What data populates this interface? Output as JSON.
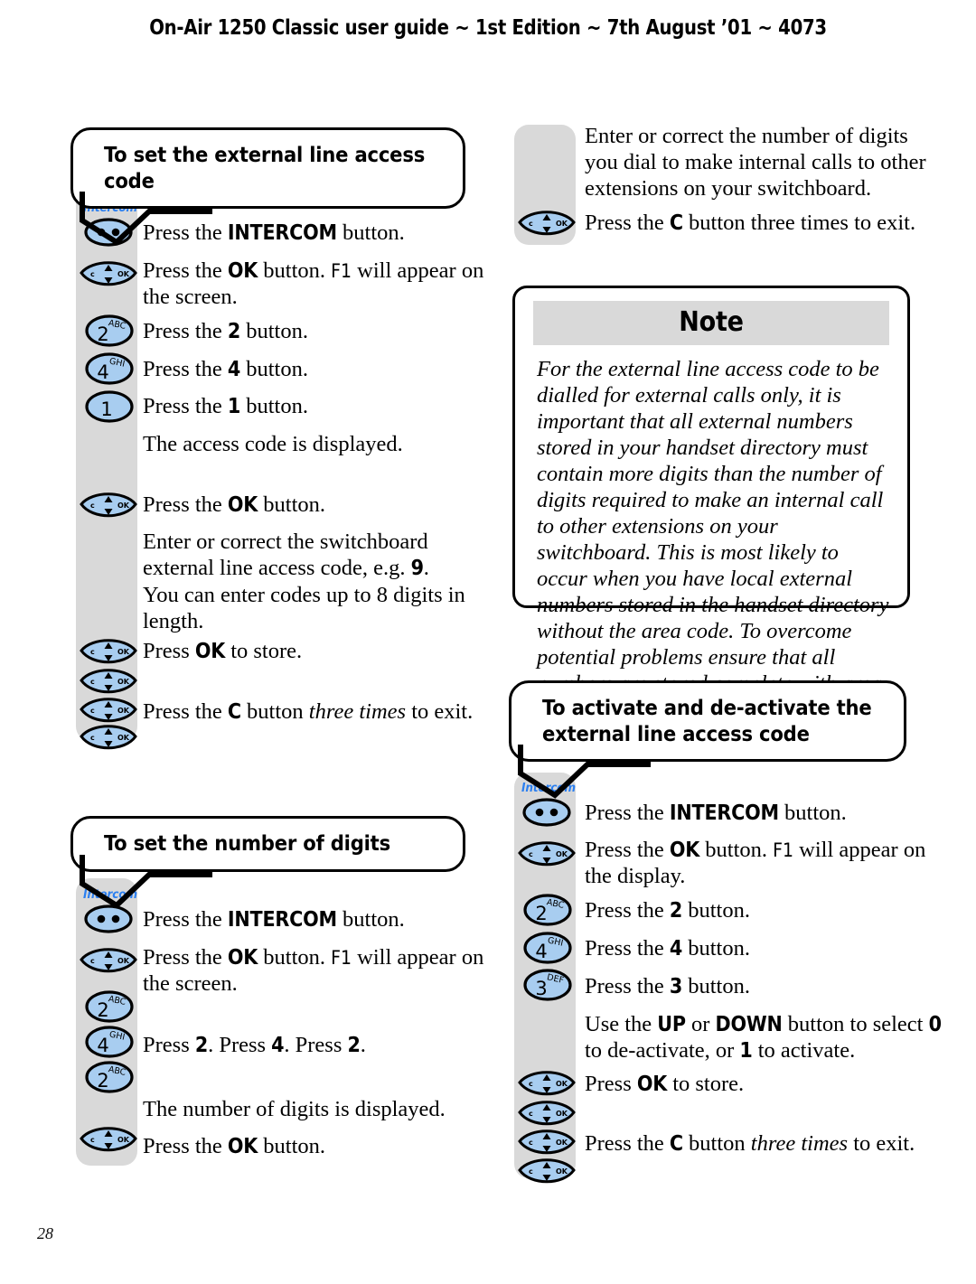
{
  "page": {
    "running_head": "On-Air 1250 Classic user guide ~ 1st Edition ~ 7th August ’01 ~ 4073",
    "page_number": "28",
    "colors": {
      "key_fill": "#a8cdf0",
      "strip_gray": "#d9d9d9",
      "intercom_blue": "#2b7ff0",
      "outline": "#000000"
    }
  },
  "sections": {
    "external_line_access_code": {
      "title": "To set the external line access code",
      "steps": [
        {
          "text_html": "Press the <b>INTERCOM</b> button.",
          "key": "intercom"
        },
        {
          "text_html": "Press the <b>OK</b> button. <span class=\"mono-f1\">F1</span> will appear on the screen.",
          "key": "nav"
        },
        {
          "text_html": "Press the <b>2</b> button.",
          "key": "2"
        },
        {
          "text_html": "Press the <b>4</b> button.",
          "key": "4"
        },
        {
          "text_html": "Press the <b>1</b> button.",
          "key": "1"
        },
        {
          "text_html": "The access code is displayed.",
          "key": null
        },
        {
          "text_html": "Press the <b>OK</b> button.",
          "key": "nav"
        },
        {
          "text_html": "Enter or correct the switchboard external line access code, e.g. <b>9</b>. You can enter codes up to 8 digits in length.",
          "key": null
        },
        {
          "text_html": "Press <b>OK</b> to store.",
          "key": "nav"
        },
        {
          "text_html": "Press the <b>C</b> button <i>three times</i> to exit.",
          "key": "nav"
        }
      ]
    },
    "number_of_digits": {
      "title": "To set the number of digits",
      "steps": [
        {
          "text_html": "Press the <b>INTERCOM</b> button.",
          "key": "intercom"
        },
        {
          "text_html": "Press the <b>OK</b> button. <span class=\"mono-f1\">F1</span> will appear on the screen.",
          "key": "nav"
        },
        {
          "text_html": "Press <b>2</b>. Press <b>4</b>. Press <b>2</b>.",
          "key": "2"
        },
        {
          "text_html": "The number of digits is displayed.",
          "key": null
        },
        {
          "text_html": "Press the <b>OK</b> button.",
          "key": "nav"
        }
      ]
    },
    "number_of_digits_cont": {
      "steps": [
        {
          "text_html": "Enter or correct the number of digits you dial to make internal calls to other extensions on your switchboard.",
          "key": null
        },
        {
          "text_html": "Press the <b>C</b> button three times to exit.",
          "key": "nav"
        }
      ]
    },
    "note": {
      "heading": "Note",
      "body": "For the external line access code to be dialled for external calls only, it is important that all external numbers stored in your handset directory must contain more digits than the number of digits required to make an internal call to other extensions on your switchboard. This is most likely to occur when you have local external numbers stored in the handset directory without the area code. To overcome potential problems ensure that all numbers are stored complete with area code."
    },
    "activate_deactivate": {
      "title_line1": "To activate and de-activate the",
      "title_line2": "external line access code",
      "steps": [
        {
          "text_html": "Press the <b>INTERCOM</b> button.",
          "key": "intercom"
        },
        {
          "text_html": "Press the <b>OK</b> button. <span class=\"mono-f1\">F1</span> will appear on the display.",
          "key": "nav"
        },
        {
          "text_html": "Press the <b>2</b> button.",
          "key": "2"
        },
        {
          "text_html": "Press the <b>4</b> button.",
          "key": "4"
        },
        {
          "text_html": "Press the <b>3</b> button.",
          "key": "3"
        },
        {
          "text_html": "Use the <b>UP</b> or <b>DOWN</b> button to select <b>0</b> to de-activate, or <b>1</b> to activate.",
          "key": null
        },
        {
          "text_html": "Press <b>OK</b> to store.",
          "key": "nav"
        },
        {
          "text_html": "Press the <b>C</b> button <i>three times</i> to exit.",
          "key": "nav"
        }
      ]
    }
  },
  "keys": {
    "intercom": {
      "name": "intercom-key",
      "label": "Intercom",
      "glyph": "two-dots"
    },
    "nav": {
      "name": "navigation-key",
      "left_label": "c",
      "right_label": "OK",
      "up": "▲",
      "down": "▼"
    },
    "1": {
      "name": "digit-key-1",
      "digit": "1",
      "letters": ""
    },
    "2": {
      "name": "digit-key-2",
      "digit": "2",
      "letters": "ABC"
    },
    "3": {
      "name": "digit-key-3",
      "digit": "3",
      "letters": "DEF"
    },
    "4": {
      "name": "digit-key-4",
      "digit": "4",
      "letters": "GHI"
    }
  }
}
